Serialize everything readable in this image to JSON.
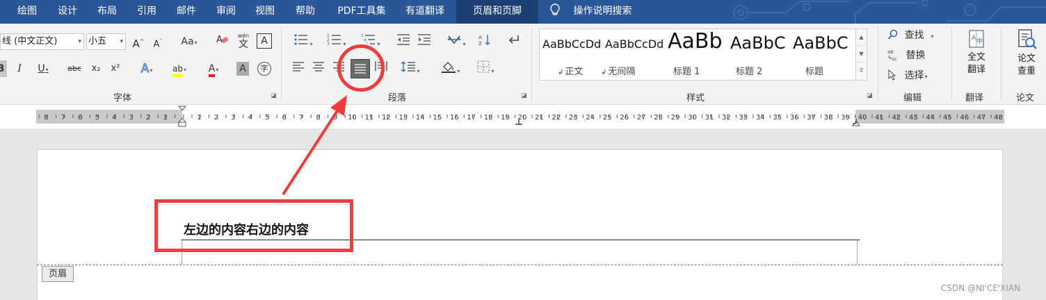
{
  "menu": {
    "tabs": [
      "绘图",
      "设计",
      "布局",
      "引用",
      "邮件",
      "审阅",
      "视图",
      "帮助",
      "PDF工具集",
      "有道翻译",
      "页眉和页脚"
    ],
    "active_tab": "页眉和页脚",
    "search_label": "操作说明搜索"
  },
  "font_group": {
    "font_name": "线 (中文正文)",
    "font_size": "小五",
    "grow_label": "A",
    "shrink_label": "A",
    "case_label": "Aa",
    "phonetic_top": "wén",
    "phonetic_char": "文",
    "border_char_label": "A",
    "bold_label": "B",
    "italic_label": "I",
    "underline_label": "U",
    "strike_label": "abc",
    "subscript_label": "x₂",
    "superscript_label": "x²",
    "effect_label": "A",
    "highlight_label": "ab",
    "color_label": "A",
    "shade_label": "A",
    "enclose_label": "字",
    "group_label": "字体"
  },
  "paragraph_group": {
    "group_label": "段落"
  },
  "styles_group": {
    "items": [
      {
        "sample": "AaBbCcDd",
        "name": "正文",
        "mark": "↲"
      },
      {
        "sample": "AaBbCcDd",
        "name": "无间隔",
        "mark": "↲"
      },
      {
        "sample": "AaBb",
        "name": "标题 1",
        "mark": ""
      },
      {
        "sample": "AaBbC",
        "name": "标题 2",
        "mark": ""
      },
      {
        "sample": "AaBbC",
        "name": "标题",
        "mark": ""
      }
    ],
    "group_label": "样式"
  },
  "edit_group": {
    "find_label": "查找",
    "replace_label": "替换",
    "select_label": "选择",
    "group_label": "编辑"
  },
  "translate_group": {
    "button_line1": "全文",
    "button_line2": "翻译",
    "group_label": "翻译"
  },
  "thesis_group": {
    "button_line1": "论文",
    "button_line2": "查重",
    "group_label": "论文"
  },
  "ruler": {
    "left_numbers": [
      "8",
      "7",
      "6",
      "5",
      "4",
      "3",
      "2",
      "1"
    ],
    "right_numbers": [
      "1",
      "2",
      "3",
      "4",
      "5",
      "6",
      "7",
      "8",
      "9",
      "10",
      "11",
      "12",
      "13",
      "14",
      "15",
      "16",
      "17",
      "18",
      "19",
      "20",
      "21",
      "22",
      "23",
      "24",
      "25",
      "26",
      "27",
      "28",
      "29",
      "30",
      "31",
      "32",
      "33",
      "34",
      "35",
      "36",
      "37",
      "38",
      "39",
      "40",
      "41",
      "42",
      "43",
      "44",
      "45",
      "46",
      "47",
      "48"
    ]
  },
  "document": {
    "header_text": "左边的内容右边的内容",
    "header_tag": "页眉"
  },
  "watermark": "CSDN @NI'CE'XIAN",
  "colors": {
    "menu_bg": "#2b579a",
    "menu_active": "#1e3f74",
    "annotation_red": "#f03c3c",
    "highlight_yellow": "#ffff00",
    "font_color_red": "#e02020"
  }
}
